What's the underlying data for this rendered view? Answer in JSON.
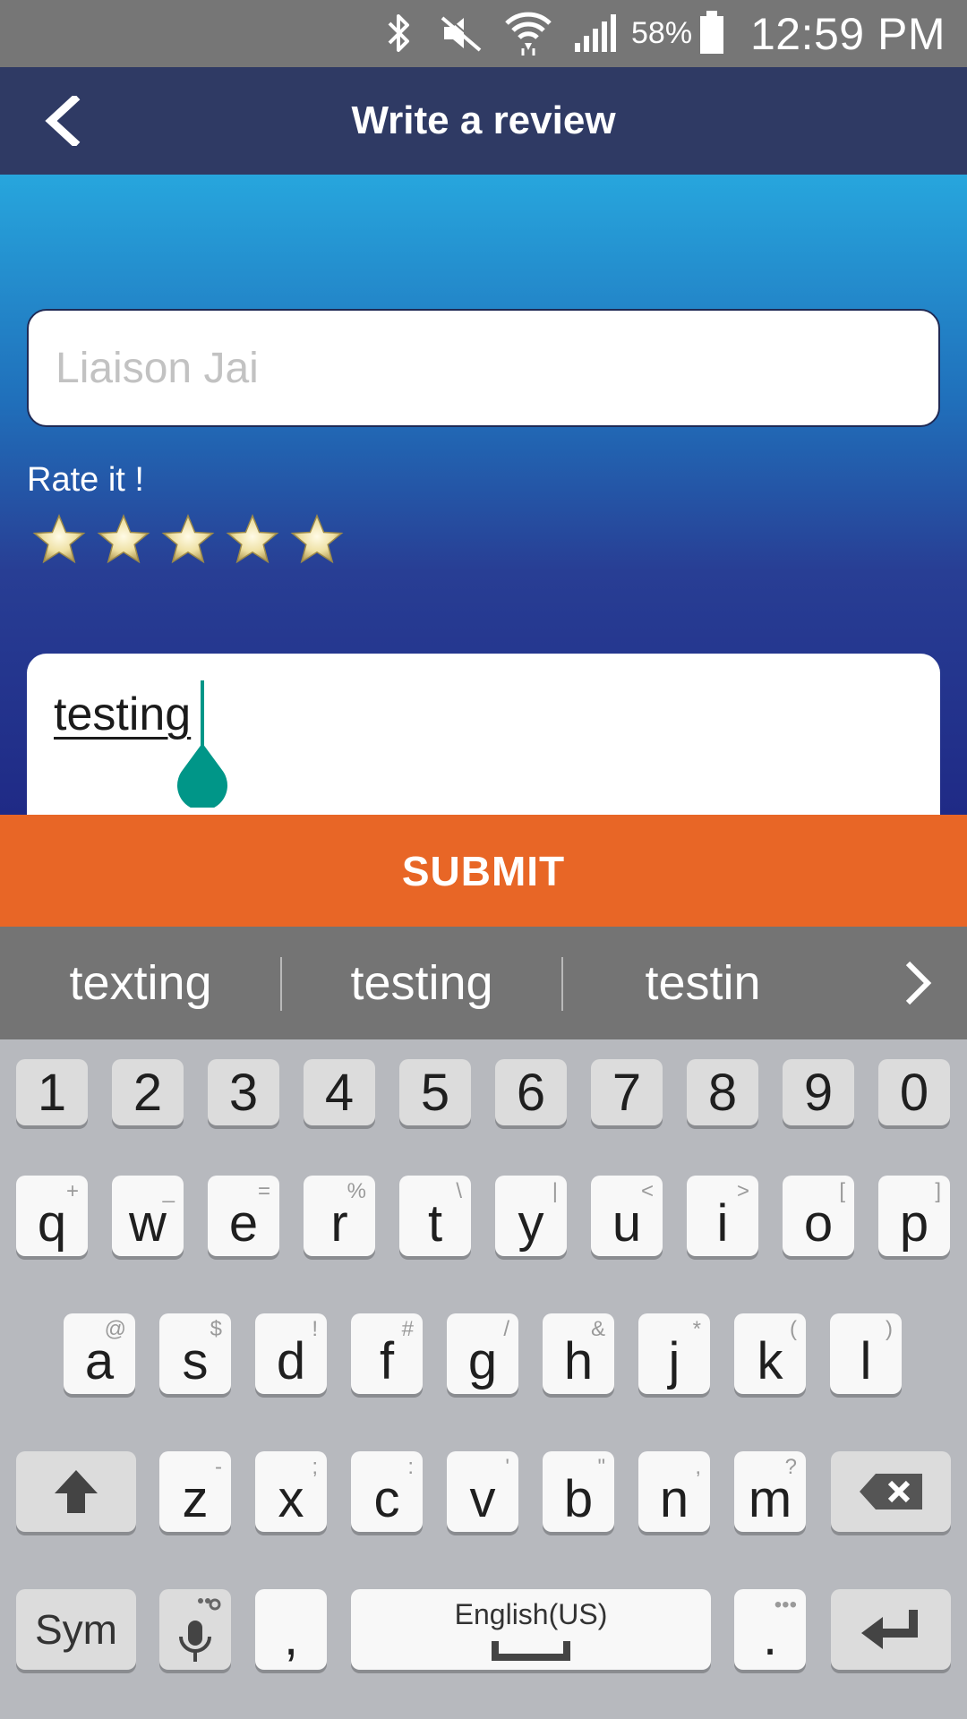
{
  "status_bar": {
    "battery_percent": "58%",
    "time": "12:59 PM"
  },
  "header": {
    "title": "Write a review"
  },
  "form": {
    "name_placeholder": "Liaison Jai",
    "rate_label": "Rate it !",
    "rating_max": 5,
    "review_text": "testing",
    "submit_label": "SUBMIT"
  },
  "suggestions": [
    "texting",
    "testing",
    "testin"
  ],
  "keyboard": {
    "number_row": [
      "1",
      "2",
      "3",
      "4",
      "5",
      "6",
      "7",
      "8",
      "9",
      "0"
    ],
    "row1": [
      {
        "key": "q",
        "hint": "+"
      },
      {
        "key": "w",
        "hint": "_"
      },
      {
        "key": "e",
        "hint": "="
      },
      {
        "key": "r",
        "hint": "%"
      },
      {
        "key": "t",
        "hint": "\\"
      },
      {
        "key": "y",
        "hint": "|"
      },
      {
        "key": "u",
        "hint": "<"
      },
      {
        "key": "i",
        "hint": ">"
      },
      {
        "key": "o",
        "hint": "["
      },
      {
        "key": "p",
        "hint": "]"
      }
    ],
    "row2": [
      {
        "key": "a",
        "hint": "@"
      },
      {
        "key": "s",
        "hint": "$"
      },
      {
        "key": "d",
        "hint": "!"
      },
      {
        "key": "f",
        "hint": "#"
      },
      {
        "key": "g",
        "hint": "/"
      },
      {
        "key": "h",
        "hint": "&"
      },
      {
        "key": "j",
        "hint": "*"
      },
      {
        "key": "k",
        "hint": "("
      },
      {
        "key": "l",
        "hint": ")"
      }
    ],
    "row3": [
      {
        "key": "z",
        "hint": "-"
      },
      {
        "key": "x",
        "hint": ";"
      },
      {
        "key": "c",
        "hint": ":"
      },
      {
        "key": "v",
        "hint": "'"
      },
      {
        "key": "b",
        "hint": "\""
      },
      {
        "key": "n",
        "hint": ","
      },
      {
        "key": "m",
        "hint": "?"
      }
    ],
    "sym_label": "Sym",
    "comma_label": ",",
    "space_label": "English(US)",
    "period_label": ".",
    "period_hint": "•••"
  },
  "colors": {
    "header_bg": "#2f3a64",
    "submit_bg": "#e86626",
    "cursor_accent": "#009688",
    "status_bar_bg": "#767676"
  }
}
